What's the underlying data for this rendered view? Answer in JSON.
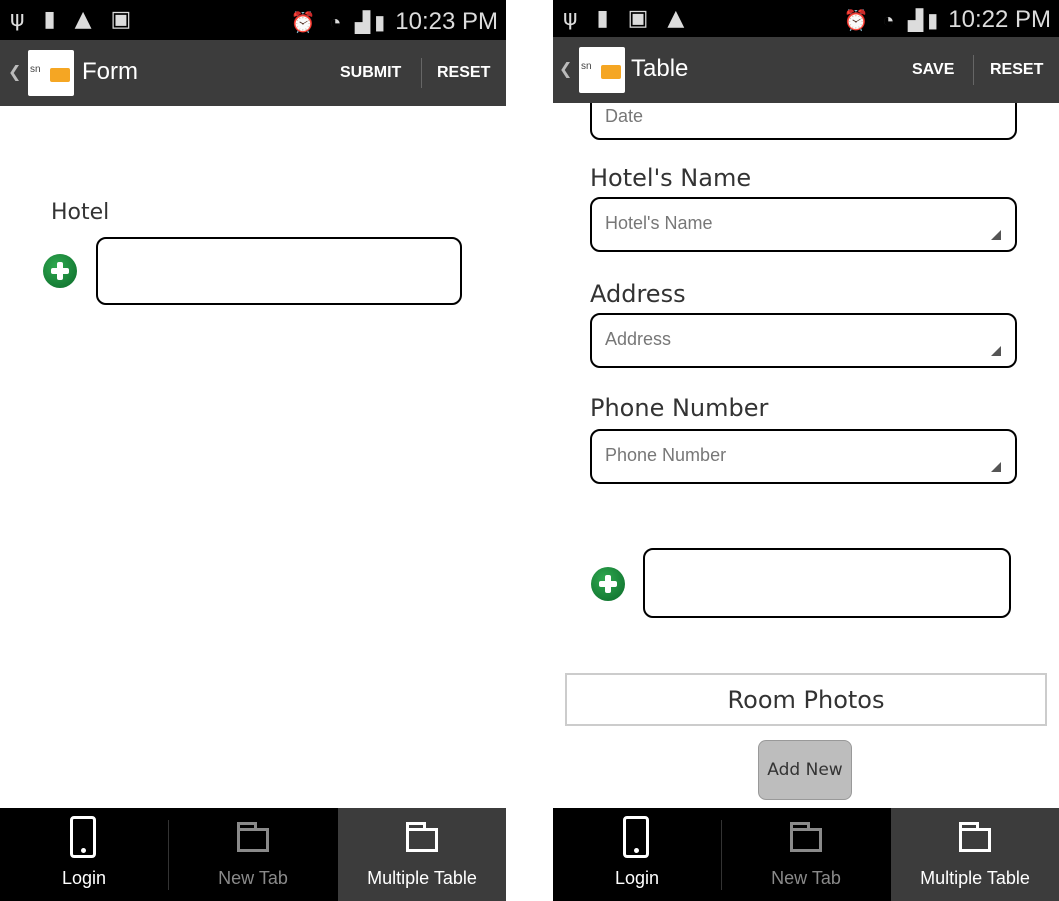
{
  "screen1": {
    "status": {
      "time": "10:23 PM",
      "left_icons": "usb-icon battery-icon warning-icon image-icon",
      "right_icons": "alarm-icon wifi-icon signal-icon battery-icon"
    },
    "actionbar": {
      "title": "Form",
      "logo_text": "sn",
      "actions": [
        "SUBMIT",
        "RESET"
      ]
    },
    "form": {
      "hotel_label": "Hotel"
    },
    "tabs": [
      {
        "label": "Login",
        "icon": "phone-icon",
        "state": "normal"
      },
      {
        "label": "New Tab",
        "icon": "folder-icon",
        "state": "dim"
      },
      {
        "label": "Multiple Table",
        "icon": "folder-icon",
        "state": "active"
      }
    ]
  },
  "screen2": {
    "status": {
      "time": "10:22 PM"
    },
    "actionbar": {
      "title": "Table",
      "logo_text": "sn",
      "actions": [
        "SAVE",
        "RESET"
      ]
    },
    "form": {
      "date_placeholder": "Date",
      "hotel_name": {
        "label": "Hotel's Name",
        "placeholder": "Hotel's Name"
      },
      "address": {
        "label": "Address",
        "placeholder": "Address"
      },
      "phone": {
        "label": "Phone Number",
        "placeholder": "Phone Number"
      },
      "room_photos": "Room Photos",
      "add_new": "Add New"
    },
    "tabs": [
      {
        "label": "Login",
        "icon": "phone-icon",
        "state": "normal"
      },
      {
        "label": "New Tab",
        "icon": "folder-icon",
        "state": "dim"
      },
      {
        "label": "Multiple Table",
        "icon": "folder-icon",
        "state": "active"
      }
    ]
  }
}
